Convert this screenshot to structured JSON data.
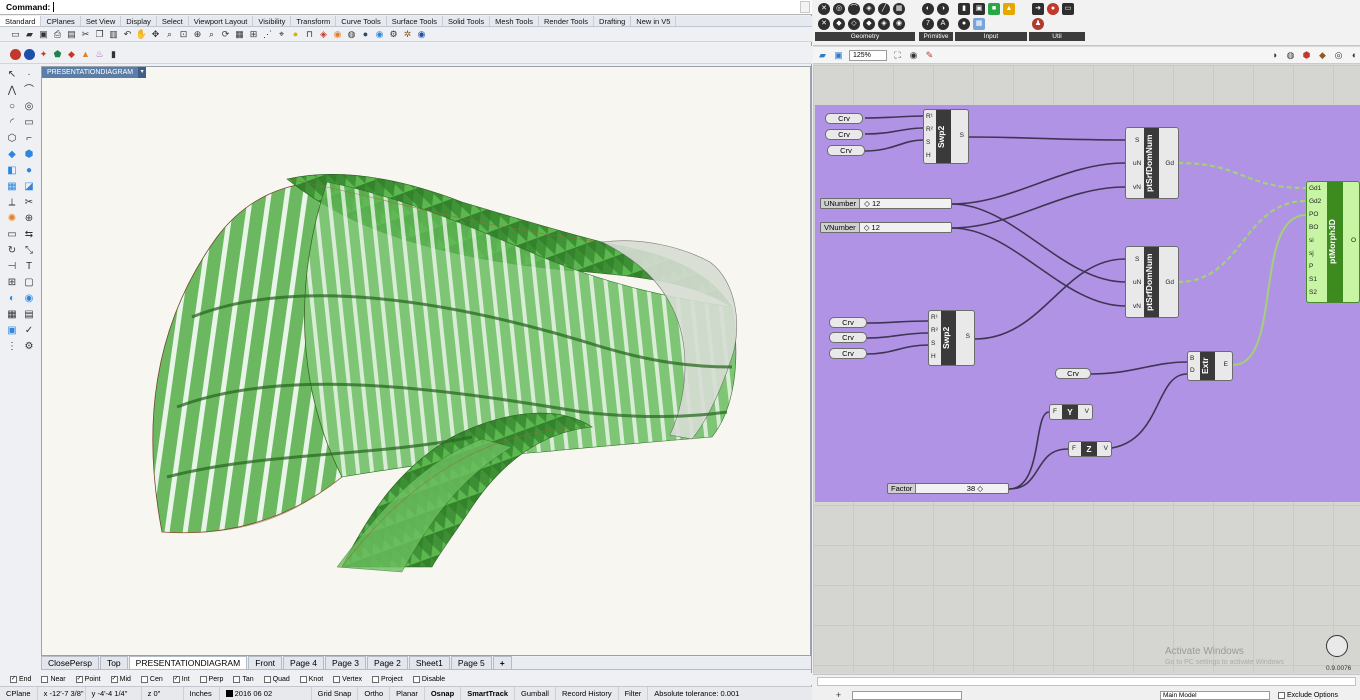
{
  "rhino": {
    "command_label": "Command:",
    "tabs": [
      "Standard",
      "CPlanes",
      "Set View",
      "Display",
      "Select",
      "Viewport Layout",
      "Visibility",
      "Transform",
      "Curve Tools",
      "Surface Tools",
      "Solid Tools",
      "Mesh Tools",
      "Render Tools",
      "Drafting",
      "New in V5"
    ],
    "active_tab": "Standard",
    "viewport_title": "PRESENTATIONDIAGRAM",
    "viewport_tabs": [
      "ClosePersp",
      "Top",
      "PRESENTATIONDIAGRAM",
      "Front",
      "Page 4",
      "Page 3",
      "Page 2",
      "Sheet1",
      "Page 5",
      "+"
    ],
    "active_viewport_tab": "PRESENTATIONDIAGRAM",
    "osnap": [
      {
        "label": "End",
        "checked": true
      },
      {
        "label": "Near",
        "checked": false
      },
      {
        "label": "Point",
        "checked": true
      },
      {
        "label": "Mid",
        "checked": true
      },
      {
        "label": "Cen",
        "checked": false
      },
      {
        "label": "Int",
        "checked": true
      },
      {
        "label": "Perp",
        "checked": false
      },
      {
        "label": "Tan",
        "checked": false
      },
      {
        "label": "Quad",
        "checked": false
      },
      {
        "label": "Knot",
        "checked": false
      },
      {
        "label": "Vertex",
        "checked": false
      },
      {
        "label": "Project",
        "checked": false
      },
      {
        "label": "Disable",
        "checked": false
      }
    ],
    "status": {
      "cplane": "CPlane",
      "x": "x -12'-7 3/8\"",
      "y": "y -4'-4 1/4\"",
      "z": "z 0\"",
      "units": "Inches",
      "layer": "2016 06 02",
      "grid_snap": "Grid Snap",
      "ortho": "Ortho",
      "planar": "Planar",
      "osnap": "Osnap",
      "smarttrack": "SmartTrack",
      "gumball": "Gumball",
      "record_history": "Record History",
      "filter": "Filter",
      "tolerance": "Absolute tolerance: 0.001"
    },
    "shape_color": "#3f9a3a"
  },
  "gh": {
    "panels": [
      "Geometry",
      "Primitive",
      "Input",
      "Util"
    ],
    "zoom": "125%",
    "group_color": "#b193e6",
    "components": {
      "swp2_top": {
        "name": "Swp2",
        "inputs": [
          "R¹",
          "R²",
          "S",
          "H"
        ],
        "output": "S"
      },
      "swp2_bottom": {
        "name": "Swp2",
        "inputs": [
          "R¹",
          "R²",
          "S",
          "H"
        ],
        "output": "S"
      },
      "ptsrf_top": {
        "name": "ptSrfDomNum",
        "inputs": [
          "S",
          "uN",
          "vN"
        ],
        "output": "Gd"
      },
      "ptsrf_bottom": {
        "name": "ptSrfDomNum",
        "inputs": [
          "S",
          "uN",
          "vN"
        ],
        "output": "Gd"
      },
      "extr": {
        "name": "Extr",
        "inputs": [
          "B",
          "D"
        ],
        "output": "E"
      },
      "unity": {
        "name": "Y",
        "input": "F",
        "output": "V"
      },
      "unitz": {
        "name": "Z",
        "input": "F",
        "output": "V"
      },
      "ptmorph": {
        "name": "ptMorph3D",
        "inputs": [
          "Gd1",
          "Gd2",
          "PO",
          "BO",
          "si",
          "sj",
          "P",
          "S1",
          "S2"
        ],
        "output": "O"
      }
    },
    "params": {
      "crv": "Crv",
      "unumber": {
        "label": "UNumber",
        "value": "◇ 12"
      },
      "vnumber": {
        "label": "VNumber",
        "value": "◇ 12"
      },
      "factor": {
        "label": "Factor",
        "value": "38 ◇"
      }
    },
    "watermark": "Activate Windows",
    "watermark_sub": "Go to PC settings to activate Windows",
    "zoom_readout": "0.9.0076",
    "bottom": {
      "model": "Main Model",
      "exclude": "Exclude Options"
    }
  }
}
